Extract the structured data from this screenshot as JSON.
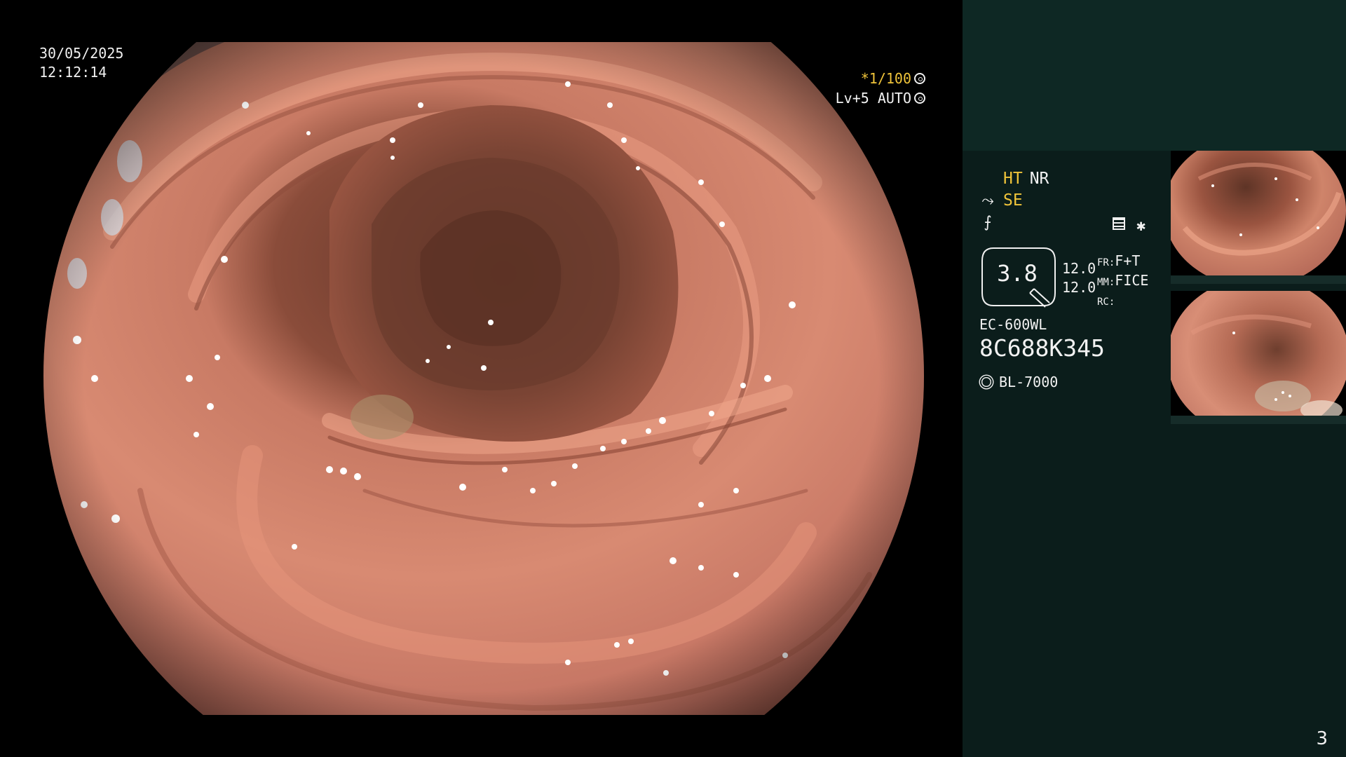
{
  "overlay": {
    "date": "30/05/2025",
    "time": "12:12:14",
    "shutter": "*1/100",
    "level": "Lv+5 AUTO"
  },
  "panel": {
    "ht": "HT",
    "nr": "NR",
    "se": "SE",
    "zoom": "3.8",
    "zoom_top": "12.0",
    "zoom_bottom": "12.0",
    "fr_key": "FR:",
    "fr_value": "F+T",
    "mm_key": "MM:",
    "mm_value": "FICE",
    "rc_key": "RC:",
    "rc_value": "",
    "scope_model": "EC-600WL",
    "scope_serial": "8C688K345",
    "light_source": "BL-7000"
  },
  "page_number": "3",
  "colors": {
    "panel_bg": "#0b1d1b",
    "panel_top": "#0e2824",
    "accent_yellow": "#f0c43a",
    "mucosa": "#c8765e"
  },
  "icons": {
    "shutter": "aperture-icon",
    "level": "aperture-icon",
    "se": "structure-enhance-icon",
    "color": "color-tone-icon",
    "freeze": "freeze-lines-icon",
    "star": "star-icon",
    "light": "light-source-icon"
  }
}
